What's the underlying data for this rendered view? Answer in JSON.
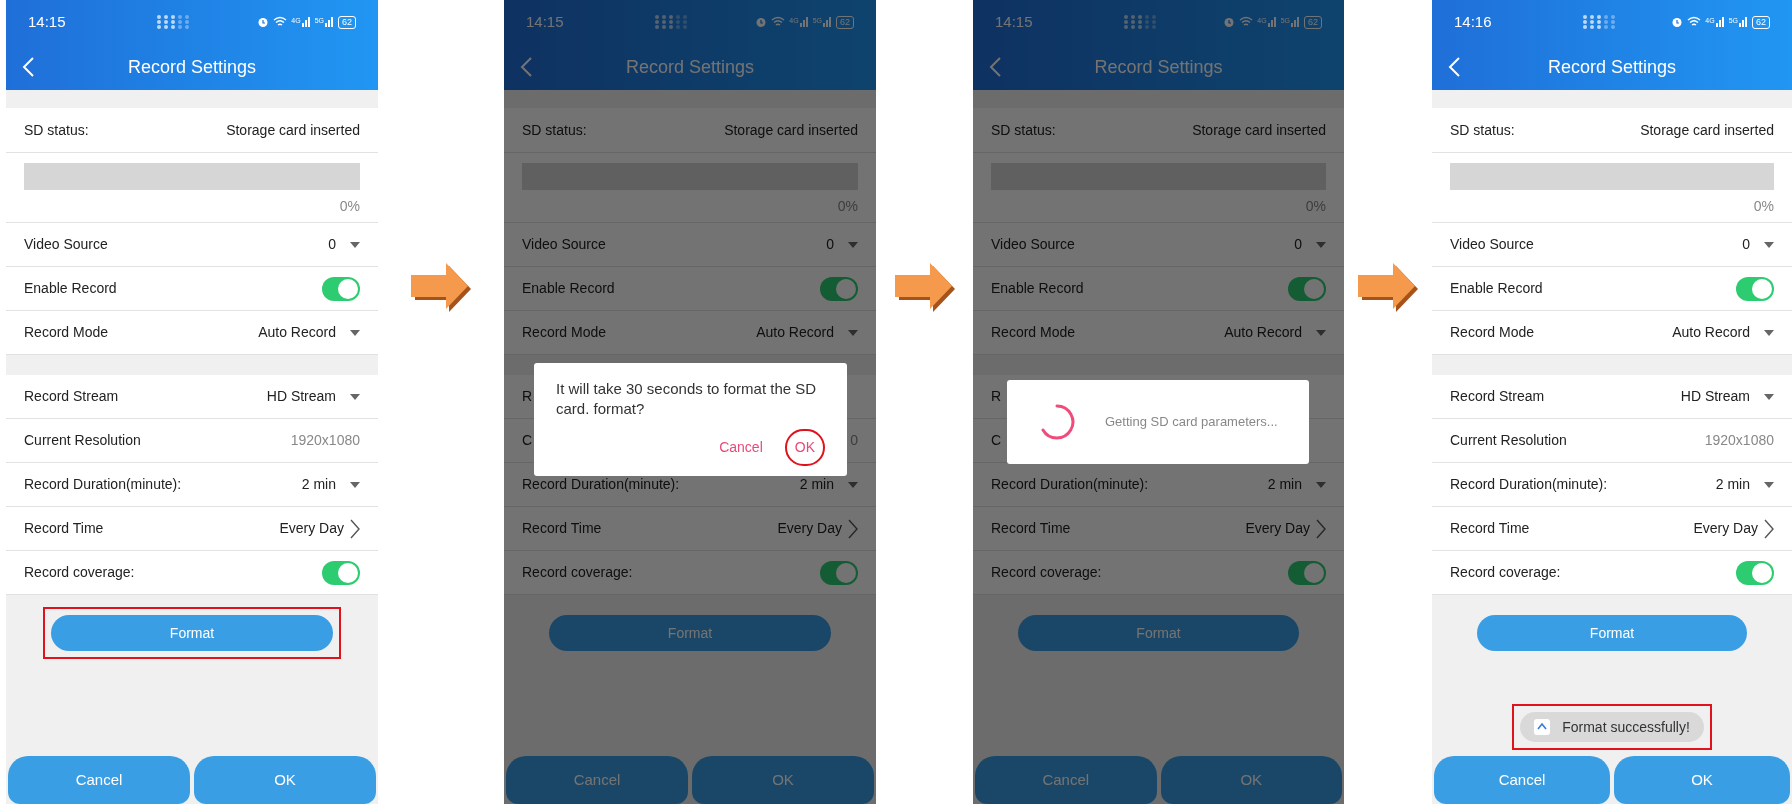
{
  "screens": [
    {
      "time": "14:15",
      "network": [
        "4G",
        "5G"
      ],
      "battery": "62",
      "title": "Record Settings",
      "dimmed": false,
      "sd_label": "SD status:",
      "sd_value": "Storage card inserted",
      "usage": {
        "level": 0,
        "reading": "0%"
      },
      "groups": [
        [
          {
            "kind": "dropdown",
            "label": "Video Source",
            "value": "0"
          },
          {
            "kind": "toggle",
            "label": "Enable Record",
            "on": true
          },
          {
            "kind": "dropdown",
            "label": "Record Mode",
            "value": "Auto Record"
          }
        ],
        [
          {
            "kind": "dropdown",
            "label": "Record Stream",
            "value": "HD Stream"
          },
          {
            "kind": "text",
            "label": "Current Resolution",
            "value": "1920x1080"
          },
          {
            "kind": "dropdown",
            "label": "Record Duration(minute):",
            "value": "2 min"
          },
          {
            "kind": "link",
            "label": "Record Time",
            "value": "Every Day"
          },
          {
            "kind": "toggle",
            "label": "Record coverage:",
            "on": true
          }
        ]
      ],
      "format": {
        "label": "Format",
        "highlighted": true
      },
      "bottom_buttons": [
        "Cancel",
        "OK"
      ]
    },
    {
      "time": "14:15",
      "network": [
        "4G",
        "5G"
      ],
      "battery": "62",
      "title": "Record Settings",
      "dimmed": true,
      "sd_label": "SD status:",
      "sd_value": "Storage card inserted",
      "usage": {
        "level": 0,
        "reading": "0%"
      },
      "groups": [
        [
          {
            "kind": "dropdown",
            "label": "Video Source",
            "value": "0"
          },
          {
            "kind": "toggle",
            "label": "Enable Record",
            "on": true
          },
          {
            "kind": "dropdown",
            "label": "Record Mode",
            "value": "Auto Record"
          }
        ],
        [
          {
            "kind": "text",
            "label": "R"
          },
          {
            "kind": "text",
            "label": "C",
            "value": "0"
          },
          {
            "kind": "dropdown",
            "label": "Record Duration(minute):",
            "value": "2 min"
          },
          {
            "kind": "link",
            "label": "Record Time",
            "value": "Every Day"
          },
          {
            "kind": "toggle",
            "label": "Record coverage:",
            "on": true
          }
        ]
      ],
      "format": {
        "label": "Format",
        "highlighted": false
      },
      "bottom_buttons": [
        "Cancel",
        "OK"
      ],
      "dialog": {
        "kind": "confirm",
        "message": "It will take 30 seconds to format the SD card. format?",
        "buttons": [
          {
            "label": "Cancel",
            "highlighted": false
          },
          {
            "label": "OK",
            "highlighted": true
          }
        ]
      }
    },
    {
      "time": "14:15",
      "network": [
        "4G",
        "5G"
      ],
      "battery": "62",
      "title": "Record Settings",
      "dimmed": true,
      "sd_label": "SD status:",
      "sd_value": "Storage card inserted",
      "usage": {
        "level": 0,
        "reading": "0%"
      },
      "groups": [
        [
          {
            "kind": "dropdown",
            "label": "Video Source",
            "value": "0"
          },
          {
            "kind": "toggle",
            "label": "Enable Record",
            "on": true
          },
          {
            "kind": "dropdown",
            "label": "Record Mode",
            "value": "Auto Record"
          }
        ],
        [
          {
            "kind": "text",
            "label": "R"
          },
          {
            "kind": "text",
            "label": "C"
          },
          {
            "kind": "dropdown",
            "label": "Record Duration(minute):",
            "value": "2 min"
          },
          {
            "kind": "link",
            "label": "Record Time",
            "value": "Every Day"
          },
          {
            "kind": "toggle",
            "label": "Record coverage:",
            "on": true
          }
        ]
      ],
      "format": {
        "label": "Format",
        "highlighted": false
      },
      "bottom_buttons": [
        "Cancel",
        "OK"
      ],
      "dialog": {
        "kind": "loading",
        "message": "Getting SD card parameters..."
      }
    },
    {
      "time": "14:16",
      "network": [
        "4G",
        "5G"
      ],
      "battery": "62",
      "title": "Record Settings",
      "dimmed": false,
      "sd_label": "SD status:",
      "sd_value": "Storage card inserted",
      "usage": {
        "level": 0,
        "reading": "0%"
      },
      "groups": [
        [
          {
            "kind": "dropdown",
            "label": "Video Source",
            "value": "0"
          },
          {
            "kind": "toggle",
            "label": "Enable Record",
            "on": true
          },
          {
            "kind": "dropdown",
            "label": "Record Mode",
            "value": "Auto Record"
          }
        ],
        [
          {
            "kind": "dropdown",
            "label": "Record Stream",
            "value": "HD Stream"
          },
          {
            "kind": "text",
            "label": "Current Resolution",
            "value": "1920x1080"
          },
          {
            "kind": "dropdown",
            "label": "Record Duration(minute):",
            "value": "2 min"
          },
          {
            "kind": "link",
            "label": "Record Time",
            "value": "Every Day"
          },
          {
            "kind": "toggle",
            "label": "Record coverage:",
            "on": true
          }
        ]
      ],
      "format": {
        "label": "Format",
        "highlighted": false
      },
      "bottom_buttons": [
        "Cancel",
        "OK"
      ],
      "toast": {
        "message": "Format successfully!",
        "highlighted": true
      }
    }
  ]
}
